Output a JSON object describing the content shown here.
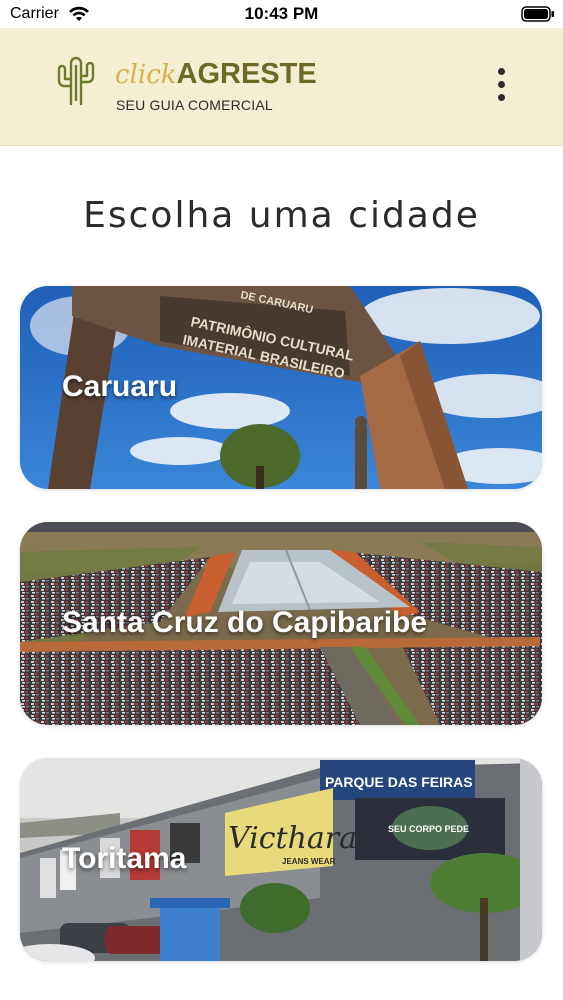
{
  "status_bar": {
    "carrier": "Carrier",
    "time": "10:43 PM"
  },
  "header": {
    "brand_click": "click",
    "brand_agreste": "AGRESTE",
    "tagline": "SEU GUIA COMERCIAL",
    "logo_icon": "cactus-icon",
    "menu_icon": "more-vertical-icon",
    "background_color": "#f4efd2"
  },
  "main": {
    "title": "Escolha uma cidade",
    "cities": [
      {
        "name": "Caruaru",
        "sign_line_1": "DE CARUARU",
        "sign_line_2": "PATRIMÔNIO CULTURAL",
        "sign_line_3": "IMATERIAL BRASILEIRO"
      },
      {
        "name": "Santa Cruz do Capibaribe"
      },
      {
        "name": "Toritama",
        "sign_parque": "PARQUE DAS FEIRAS",
        "sign_victhara": "Victhara",
        "sign_jeans": "JEANS WEAR",
        "sign_corpo": "SEU CORPO PEDE"
      }
    ]
  }
}
